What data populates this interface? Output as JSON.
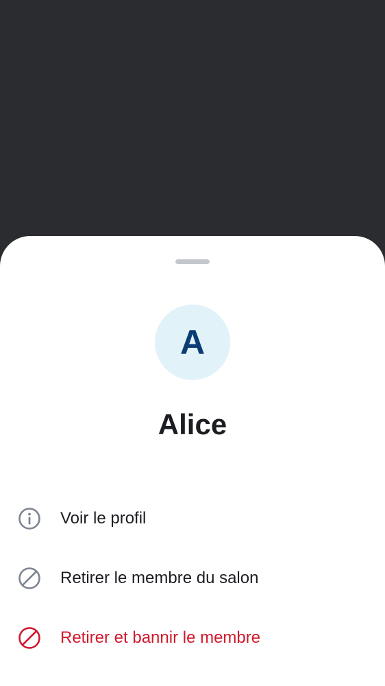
{
  "member": {
    "avatar_initial": "A",
    "display_name": "Alice"
  },
  "actions": [
    {
      "label": "Voir le profil",
      "icon": "info-icon"
    },
    {
      "label": "Retirer le membre du salon",
      "icon": "block-icon"
    },
    {
      "label": "Retirer et bannir le membre",
      "icon": "ban-icon"
    }
  ],
  "colors": {
    "backdrop": "#2b2c2f",
    "sheet": "#ffffff",
    "avatar_bg": "#e1f2f8",
    "avatar_text": "#0a3d73",
    "text_primary": "#1b1d22",
    "icon_gray": "#7b8490",
    "danger": "#d1182c"
  }
}
